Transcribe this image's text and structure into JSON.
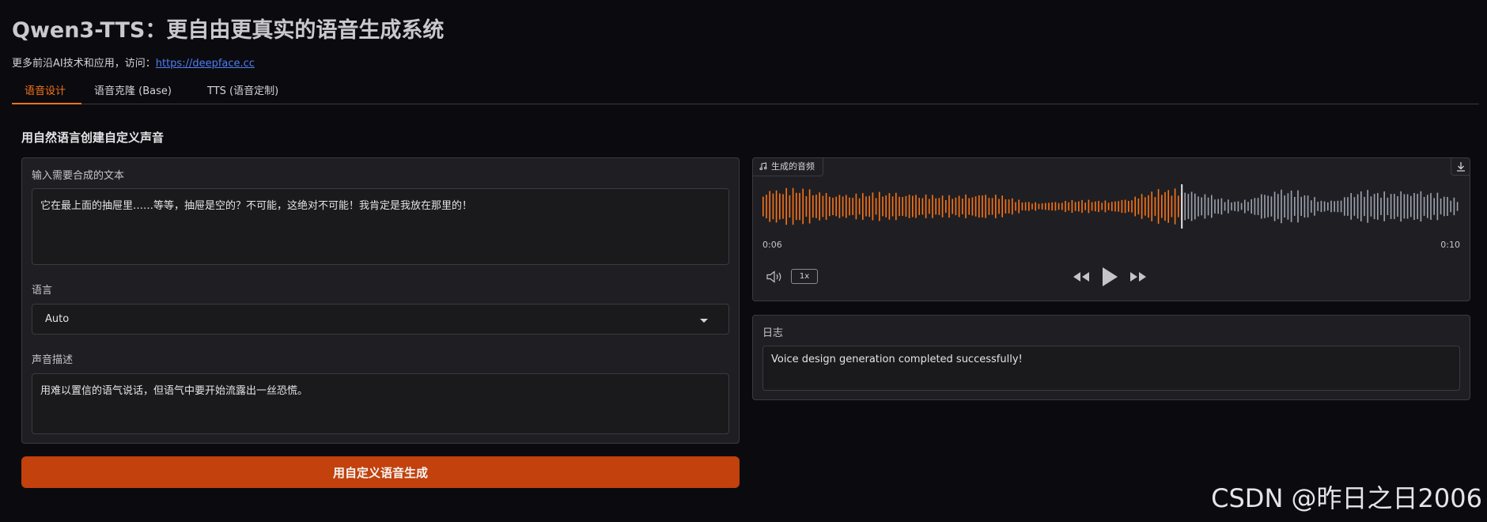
{
  "app": {
    "title": "Qwen3-TTS：更自由更真实的语音生成系统",
    "subtitle_text": "更多前沿AI技术和应用，访问：",
    "subtitle_link": "https://deepface.cc"
  },
  "tabs": [
    {
      "label": "语音设计",
      "active": true
    },
    {
      "label": "语音克隆 (Base)",
      "active": false
    },
    {
      "label": "TTS (语音定制)",
      "active": false
    }
  ],
  "section_title": "用自然语言创建自定义声音",
  "form": {
    "text_label": "输入需要合成的文本",
    "text_value": "它在最上面的抽屉里……等等，抽屉是空的？不可能，这绝对不可能！我肯定是我放在那里的！",
    "language_label": "语言",
    "language_value": "Auto",
    "voice_desc_label": "声音描述",
    "voice_desc_value": "用难以置信的语气说话，但语气中要开始流露出一丝恐慌。"
  },
  "generate_button": "用自定义语音生成",
  "audio": {
    "label": "生成的音频",
    "current_time": "0:06",
    "duration": "0:10",
    "progress": 0.6,
    "playback_rate": "1x",
    "played_color": "#f97316",
    "unplayed_color": "#9ca3af"
  },
  "log": {
    "label": "日志",
    "message": "Voice design generation completed successfully!"
  },
  "watermark": "CSDN @昨日之日2006"
}
